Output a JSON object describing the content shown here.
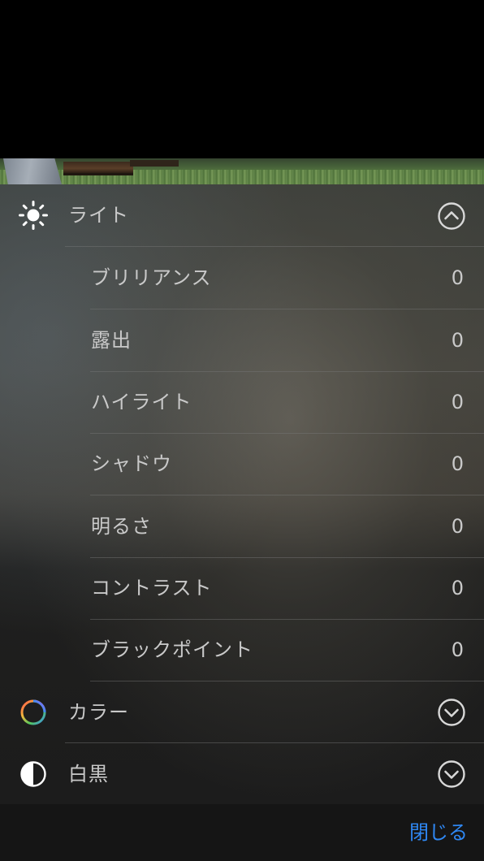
{
  "sections": {
    "light": {
      "title": "ライト",
      "icon": "sun-icon",
      "expanded": true,
      "items": [
        {
          "label": "ブリリアンス",
          "value": "0"
        },
        {
          "label": "露出",
          "value": "0"
        },
        {
          "label": "ハイライト",
          "value": "0"
        },
        {
          "label": "シャドウ",
          "value": "0"
        },
        {
          "label": "明るさ",
          "value": "0"
        },
        {
          "label": "コントラスト",
          "value": "0"
        },
        {
          "label": "ブラックポイント",
          "value": "0"
        }
      ]
    },
    "color": {
      "title": "カラー",
      "icon": "color-wheel-icon",
      "expanded": false
    },
    "bw": {
      "title": "白黒",
      "icon": "half-circle-icon",
      "expanded": false
    }
  },
  "footer": {
    "close_label": "閉じる"
  },
  "colors": {
    "accent": "#2f88f4",
    "text": "#c9c9c9"
  }
}
